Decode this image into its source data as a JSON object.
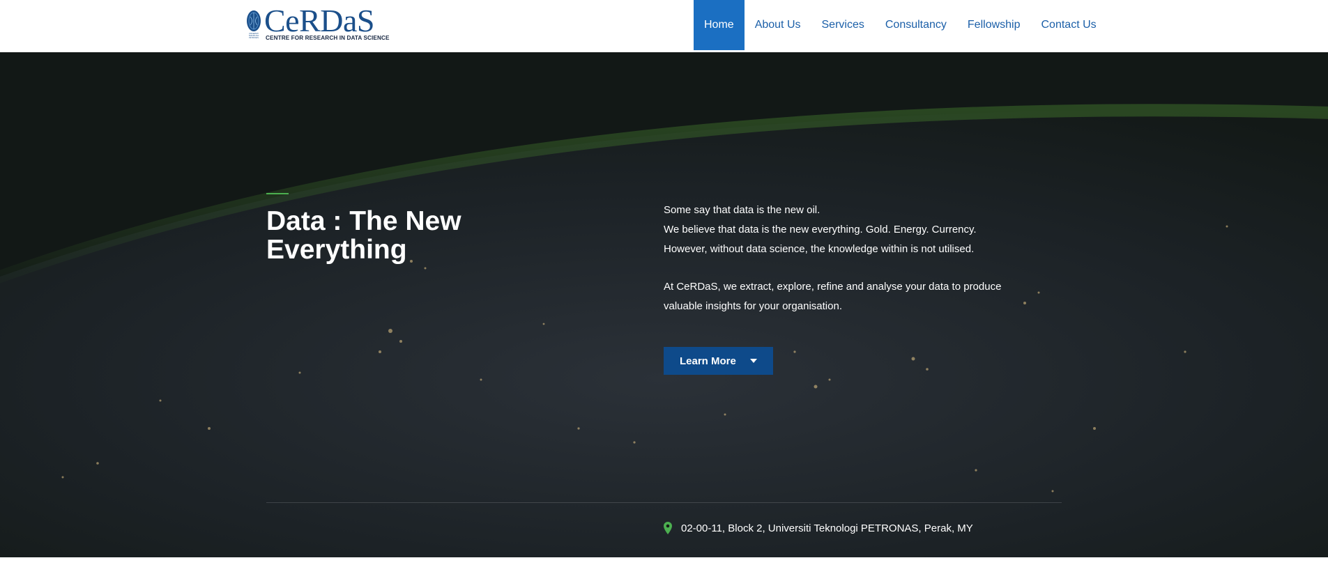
{
  "brand": {
    "name": "CeRDaS",
    "tagline": "CENTRE FOR RESEARCH IN DATA SCIENCE",
    "emblem_caption": "UNIVERSITI TEKNOLOGI PETRONAS",
    "color": "#1b4f8a"
  },
  "nav": {
    "items": [
      {
        "label": "Home",
        "active": true
      },
      {
        "label": "About Us",
        "active": false
      },
      {
        "label": "Services",
        "active": false
      },
      {
        "label": "Consultancy",
        "active": false
      },
      {
        "label": "Fellowship",
        "active": false
      },
      {
        "label": "Contact Us",
        "active": false
      }
    ],
    "active_color": "#1b6fc2",
    "link_color": "#1b5fa8"
  },
  "hero": {
    "title": "Data : The New Everything",
    "paragraph1": [
      "Some say that data is the new oil.",
      "We believe that data is the new everything. Gold. Energy. Currency.",
      "However, without data science, the knowledge within is not utilised."
    ],
    "paragraph2": [
      "At CeRDaS, we extract, explore, refine and analyse your data to produce",
      "valuable insights for your organisation."
    ],
    "button_label": "Learn More",
    "button_icon": "caret-down-icon",
    "button_color": "#0e4a8a",
    "accent_color": "#4caf50"
  },
  "footer_info": {
    "address": "02-00-11, Block 2, Universiti Teknologi PETRONAS, Perak, MY",
    "icon": "map-marker-icon"
  }
}
